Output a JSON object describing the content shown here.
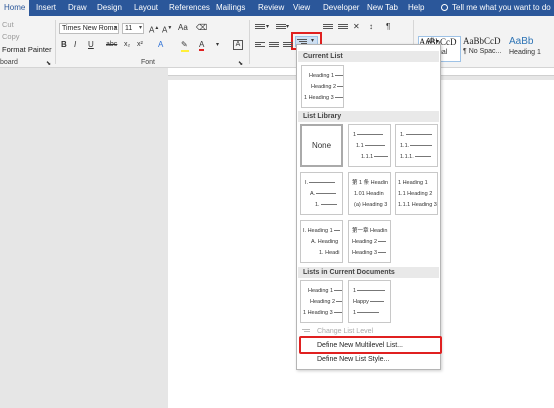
{
  "ribbon_tabs": [
    {
      "label": "Home",
      "active": true
    },
    {
      "label": "Insert"
    },
    {
      "label": "Draw"
    },
    {
      "label": "Design"
    },
    {
      "label": "Layout"
    },
    {
      "label": "References"
    },
    {
      "label": "Mailings"
    },
    {
      "label": "Review"
    },
    {
      "label": "View"
    },
    {
      "label": "Developer"
    },
    {
      "label": "New Tab"
    },
    {
      "label": "Help"
    }
  ],
  "tell_me": "Tell me what you want to do",
  "clipboard": {
    "cut": "Cut",
    "copy": "Copy",
    "format_painter": "Format Painter",
    "group_label": "board"
  },
  "font": {
    "name": "Times New Roma",
    "size": "11",
    "group_label": "Font"
  },
  "font_buttons": [
    "B",
    "I",
    "U",
    "abc",
    "x₂",
    "x²",
    "A",
    "A"
  ],
  "styles": [
    {
      "preview": "AaBbCcD",
      "name": "¶ Normal"
    },
    {
      "preview": "AaBbCcD",
      "name": "¶ No Spac..."
    },
    {
      "preview": "AaBb",
      "name": "Heading 1"
    }
  ],
  "all_label": "All",
  "multilevel_menu": {
    "current_list_header": "Current List",
    "list_library_header": "List Library",
    "lists_in_docs_header": "Lists in Current Documents",
    "none_label": "None",
    "current_tile": [
      "Heading 1",
      "Heading 2",
      "1 Heading 3"
    ],
    "library_tiles": [
      [
        "1",
        "1.1",
        "1.1.1"
      ],
      [
        "1.",
        "1.1.",
        "1.1.1."
      ],
      [
        "I.",
        "A.",
        "1."
      ],
      [
        "第 1 条 Headin",
        "1.01 Headin",
        "(a) Heading 3"
      ],
      [
        "1 Heading 1",
        "1.1 Heading 2",
        "1.1.1 Heading 3"
      ],
      [
        "I. Heading 1",
        "A. Heading",
        "1. Headi"
      ],
      [
        "第一章 Headin",
        "Heading 2",
        "Heading 3"
      ]
    ],
    "doc_tiles": [
      [
        "Heading 1",
        "Heading 2",
        "1 Heading 3"
      ],
      [
        "1",
        "Happy",
        "1"
      ]
    ],
    "change_level": "Change List Level",
    "define_multilevel": "Define New Multilevel List...",
    "define_style": "Define New List Style..."
  }
}
